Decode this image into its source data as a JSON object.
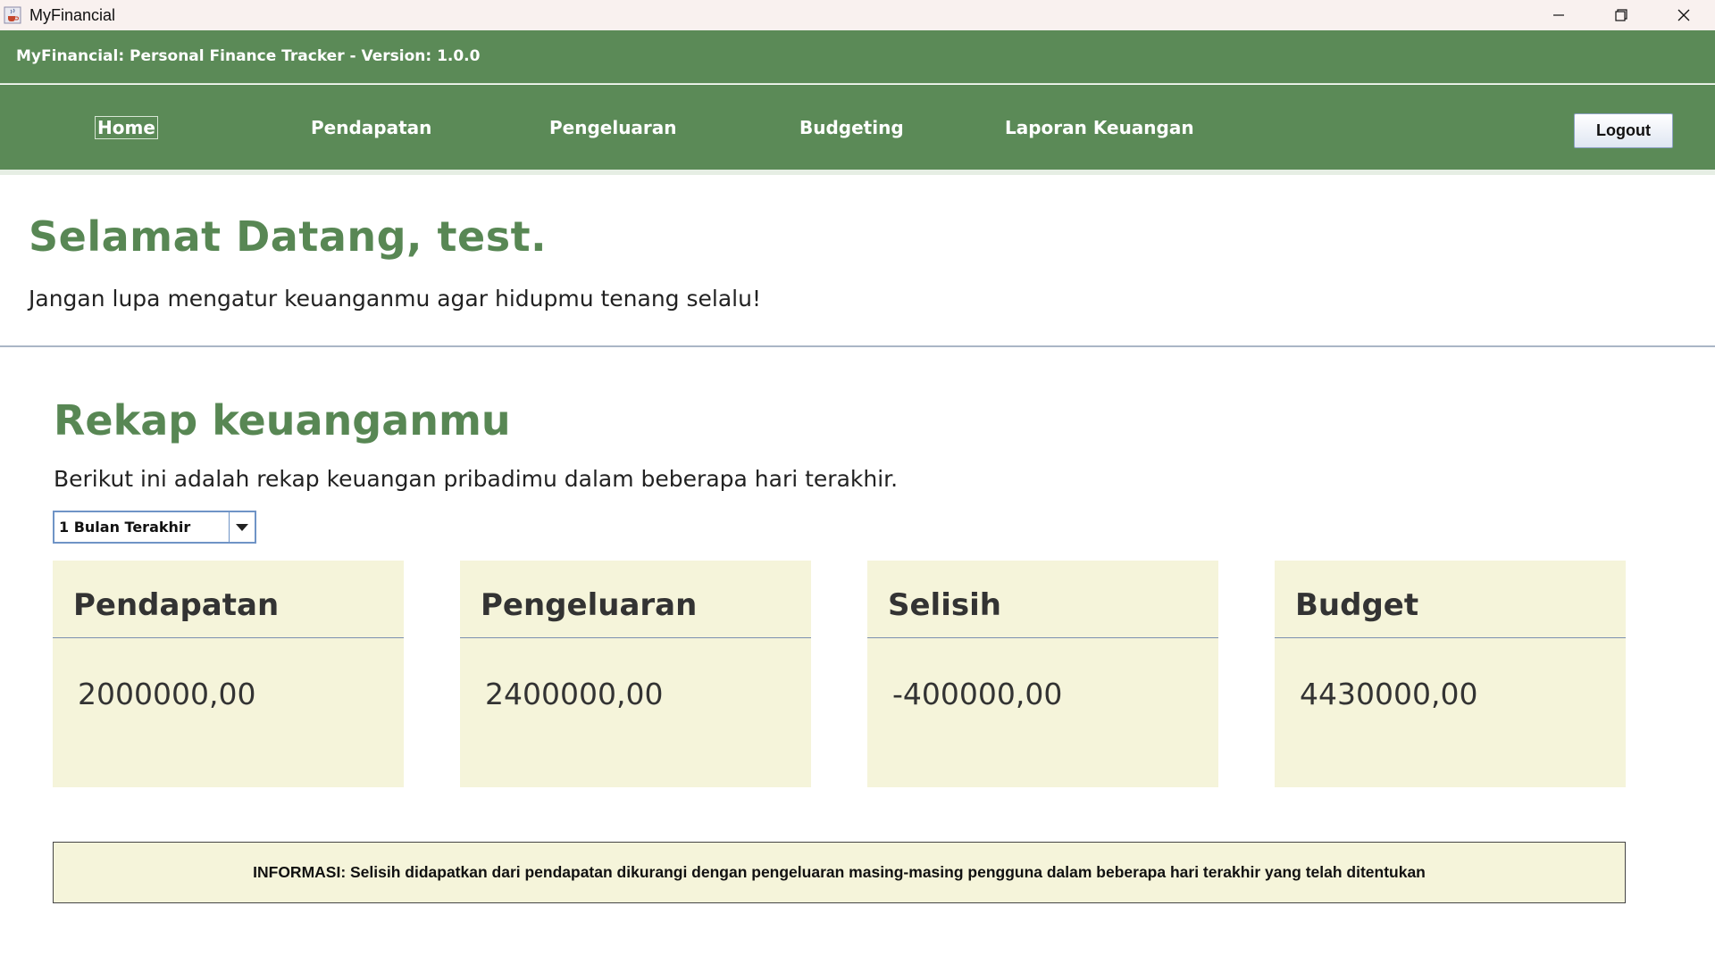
{
  "window": {
    "title": "MyFinancial",
    "icon": "java-cup-icon",
    "controls": [
      "minimize-icon",
      "restore-icon",
      "close-icon"
    ]
  },
  "header": {
    "version_text": "MyFinancial: Personal Finance Tracker - Version: 1.0.0"
  },
  "nav": {
    "items": [
      {
        "label": "Home",
        "active": true
      },
      {
        "label": "Pendapatan",
        "active": false
      },
      {
        "label": "Pengeluaran",
        "active": false
      },
      {
        "label": "Budgeting",
        "active": false
      },
      {
        "label": "Laporan Keuangan",
        "active": false
      }
    ],
    "logout_label": "Logout"
  },
  "welcome": {
    "title": "Selamat Datang, test.",
    "subtitle": "Jangan lupa mengatur keuanganmu agar hidupmu tenang selalu!"
  },
  "recap": {
    "title": "Rekap keuanganmu",
    "subtitle": "Berikut ini adalah rekap keuangan pribadimu dalam beberapa hari terakhir.",
    "period_selected": "1 Bulan Terakhir"
  },
  "cards": [
    {
      "title": "Pendapatan",
      "value": "2000000,00"
    },
    {
      "title": "Pengeluaran",
      "value": "2400000,00"
    },
    {
      "title": "Selisih",
      "value": "-400000,00"
    },
    {
      "title": "Budget",
      "value": "4430000,00"
    }
  ],
  "info": {
    "text": "INFORMASI: Selisih didapatkan dari pendapatan dikurangi dengan pengeluaran masing-masing pengguna dalam beberapa hari terakhir yang telah ditentukan"
  },
  "colors": {
    "header_green": "#5b8a57",
    "title_green": "#588754",
    "card_bg": "#f5f4da"
  }
}
